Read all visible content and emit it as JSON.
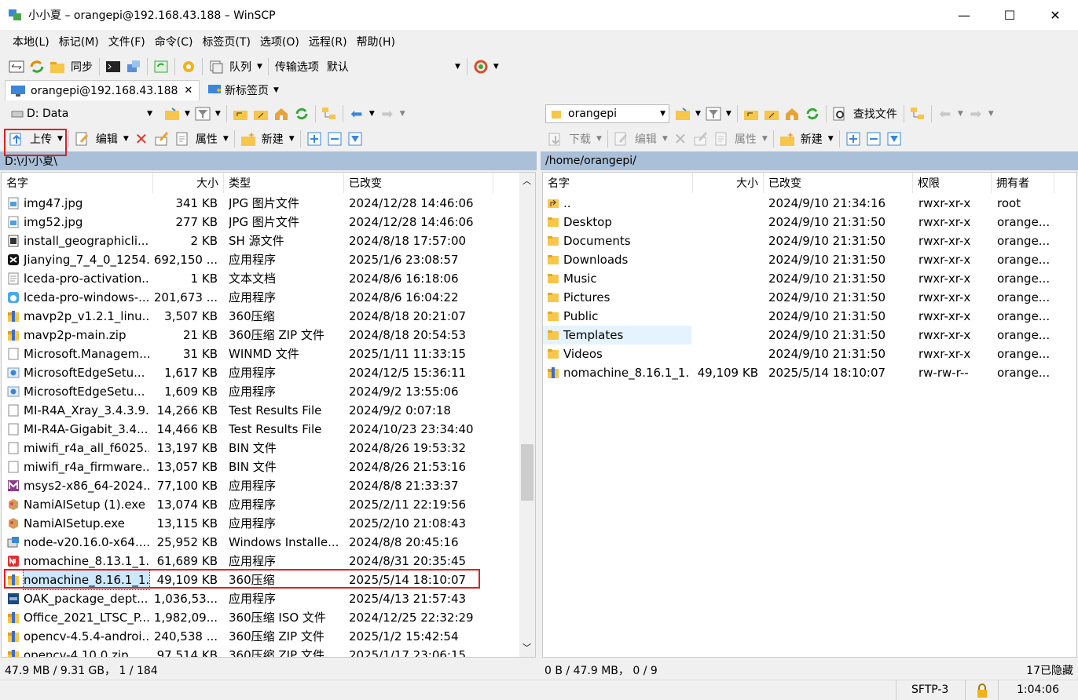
{
  "window": {
    "title": "小小夏 – orangepi@192.168.43.188 – WinSCP"
  },
  "menu": [
    "本地(L)",
    "标记(M)",
    "文件(F)",
    "命令(C)",
    "标签页(T)",
    "选项(O)",
    "远程(R)",
    "帮助(H)"
  ],
  "toolbar": {
    "sync": "同步",
    "queue": "队列",
    "transfer_label": "传输选项",
    "transfer_value": "默认"
  },
  "tabs": {
    "session": "orangepi@192.168.43.188",
    "new_tab": "新标签页"
  },
  "local": {
    "drive": "D: Data",
    "upload": "上传",
    "edit": "编辑",
    "properties": "属性",
    "new": "新建",
    "path": "D:\\小小夏\\",
    "headers": [
      "名字",
      "大小",
      "类型",
      "已改变"
    ],
    "files": [
      {
        "name": "img47.jpg",
        "size": "341 KB",
        "type": "JPG 图片文件",
        "modified": "2024/12/28 14:46:06",
        "icon": "image"
      },
      {
        "name": "img52.jpg",
        "size": "277 KB",
        "type": "JPG 图片文件",
        "modified": "2024/12/28 14:46:06",
        "icon": "image"
      },
      {
        "name": "install_geographicli...",
        "size": "2 KB",
        "type": "SH 源文件",
        "modified": "2024/8/18 17:57:00",
        "icon": "script"
      },
      {
        "name": "Jianying_7_4_0_1254...",
        "size": "692,150 ...",
        "type": "应用程序",
        "modified": "2025/1/6 23:08:57",
        "icon": "capcut"
      },
      {
        "name": "lceda-pro-activation...",
        "size": "1 KB",
        "type": "文本文档",
        "modified": "2024/8/6 16:18:06",
        "icon": "text"
      },
      {
        "name": "lceda-pro-windows-...",
        "size": "201,673 ...",
        "type": "应用程序",
        "modified": "2024/8/6 16:04:22",
        "icon": "cloud-app"
      },
      {
        "name": "mavp2p_v1.2.1_linu...",
        "size": "3,507 KB",
        "type": "360压缩",
        "modified": "2024/8/18 20:21:07",
        "icon": "archive"
      },
      {
        "name": "mavp2p-main.zip",
        "size": "21 KB",
        "type": "360压缩 ZIP 文件",
        "modified": "2024/8/18 20:54:53",
        "icon": "archive"
      },
      {
        "name": "Microsoft.Managem...",
        "size": "31 KB",
        "type": "WINMD 文件",
        "modified": "2025/1/11 11:33:15",
        "icon": "blank"
      },
      {
        "name": "MicrosoftEdgeSetu...",
        "size": "1,617 KB",
        "type": "应用程序",
        "modified": "2024/12/5 15:36:11",
        "icon": "installer"
      },
      {
        "name": "MicrosoftEdgeSetu...",
        "size": "1,609 KB",
        "type": "应用程序",
        "modified": "2024/9/2 13:55:06",
        "icon": "installer"
      },
      {
        "name": "MI-R4A_Xray_3.4.3.9...",
        "size": "14,266 KB",
        "type": "Test Results File",
        "modified": "2024/9/2 0:07:18",
        "icon": "blank"
      },
      {
        "name": "MI-R4A-Gigabit_3.4....",
        "size": "14,466 KB",
        "type": "Test Results File",
        "modified": "2024/10/23 23:34:40",
        "icon": "blank"
      },
      {
        "name": "miwifi_r4a_all_f6025...",
        "size": "13,197 KB",
        "type": "BIN 文件",
        "modified": "2024/8/26 19:53:32",
        "icon": "blank"
      },
      {
        "name": "miwifi_r4a_firmware...",
        "size": "13,057 KB",
        "type": "BIN 文件",
        "modified": "2024/8/26 21:53:16",
        "icon": "blank"
      },
      {
        "name": "msys2-x86_64-2024...",
        "size": "77,100 KB",
        "type": "应用程序",
        "modified": "2024/8/8 21:33:37",
        "icon": "msys"
      },
      {
        "name": "NamiAISetup (1).exe",
        "size": "13,074 KB",
        "type": "应用程序",
        "modified": "2025/2/11 22:19:56",
        "icon": "package"
      },
      {
        "name": "NamiAISetup.exe",
        "size": "13,115 KB",
        "type": "应用程序",
        "modified": "2025/2/10 21:08:43",
        "icon": "package"
      },
      {
        "name": "node-v20.16.0-x64....",
        "size": "25,952 KB",
        "type": "Windows Installe...",
        "modified": "2024/8/8 20:45:16",
        "icon": "msi"
      },
      {
        "name": "nomachine_8.13.1_1...",
        "size": "61,689 KB",
        "type": "应用程序",
        "modified": "2024/8/31 20:35:45",
        "icon": "nomachine"
      },
      {
        "name": "nomachine_8.16.1_1...",
        "size": "49,109 KB",
        "type": "360压缩",
        "modified": "2025/5/14 18:10:07",
        "icon": "archive",
        "selected": true
      },
      {
        "name": "OAK_package_dept...",
        "size": "1,036,53...",
        "type": "应用程序",
        "modified": "2025/4/13 21:57:43",
        "icon": "oak"
      },
      {
        "name": "Office_2021_LTSC_P...",
        "size": "1,982,09...",
        "type": "360压缩 ISO 文件",
        "modified": "2024/12/25 22:32:29",
        "icon": "archive"
      },
      {
        "name": "opencv-4.5.4-androi...",
        "size": "240,538 ...",
        "type": "360压缩 ZIP 文件",
        "modified": "2025/1/2 15:42:54",
        "icon": "archive"
      },
      {
        "name": "opencv-4.10.0.zip",
        "size": "97,514 KB",
        "type": "360压缩 ZIP 文件",
        "modified": "2025/1/17 23:06:15",
        "icon": "archive"
      }
    ],
    "status": "47.9 MB / 9.31 GB， 1 / 184"
  },
  "remote": {
    "dir": "orangepi",
    "find": "查找文件",
    "download": "下载",
    "edit": "编辑",
    "properties": "属性",
    "new": "新建",
    "path": "/home/orangepi/",
    "headers": [
      "名字",
      "大小",
      "已改变",
      "权限",
      "拥有者"
    ],
    "files": [
      {
        "name": "..",
        "size": "",
        "modified": "2024/9/10 21:34:16",
        "perm": "rwxr-xr-x",
        "owner": "root",
        "icon": "up"
      },
      {
        "name": "Desktop",
        "size": "",
        "modified": "2024/9/10 21:31:50",
        "perm": "rwxr-xr-x",
        "owner": "orange...",
        "icon": "folder"
      },
      {
        "name": "Documents",
        "size": "",
        "modified": "2024/9/10 21:31:50",
        "perm": "rwxr-xr-x",
        "owner": "orange...",
        "icon": "folder"
      },
      {
        "name": "Downloads",
        "size": "",
        "modified": "2024/9/10 21:31:50",
        "perm": "rwxr-xr-x",
        "owner": "orange...",
        "icon": "folder"
      },
      {
        "name": "Music",
        "size": "",
        "modified": "2024/9/10 21:31:50",
        "perm": "rwxr-xr-x",
        "owner": "orange...",
        "icon": "folder"
      },
      {
        "name": "Pictures",
        "size": "",
        "modified": "2024/9/10 21:31:50",
        "perm": "rwxr-xr-x",
        "owner": "orange...",
        "icon": "folder"
      },
      {
        "name": "Public",
        "size": "",
        "modified": "2024/9/10 21:31:50",
        "perm": "rwxr-xr-x",
        "owner": "orange...",
        "icon": "folder"
      },
      {
        "name": "Templates",
        "size": "",
        "modified": "2024/9/10 21:31:50",
        "perm": "rwxr-xr-x",
        "owner": "orange...",
        "icon": "folder",
        "hover": true
      },
      {
        "name": "Videos",
        "size": "",
        "modified": "2024/9/10 21:31:50",
        "perm": "rwxr-xr-x",
        "owner": "orange...",
        "icon": "folder"
      },
      {
        "name": "nomachine_8.16.1_1...",
        "size": "49,109 KB",
        "modified": "2025/5/14 18:10:07",
        "perm": "rw-rw-r--",
        "owner": "orange...",
        "icon": "archive"
      }
    ],
    "status": "0 B / 47.9 MB， 0 / 9",
    "hidden": "17已隐藏"
  },
  "bottom": {
    "protocol": "SFTP-3",
    "time": "1:04:06"
  },
  "colors": {
    "path_bar": "#a9c0d8",
    "selection": "#cce8ff",
    "highlight_box": "#e02020",
    "folder": "#f7c64a"
  }
}
